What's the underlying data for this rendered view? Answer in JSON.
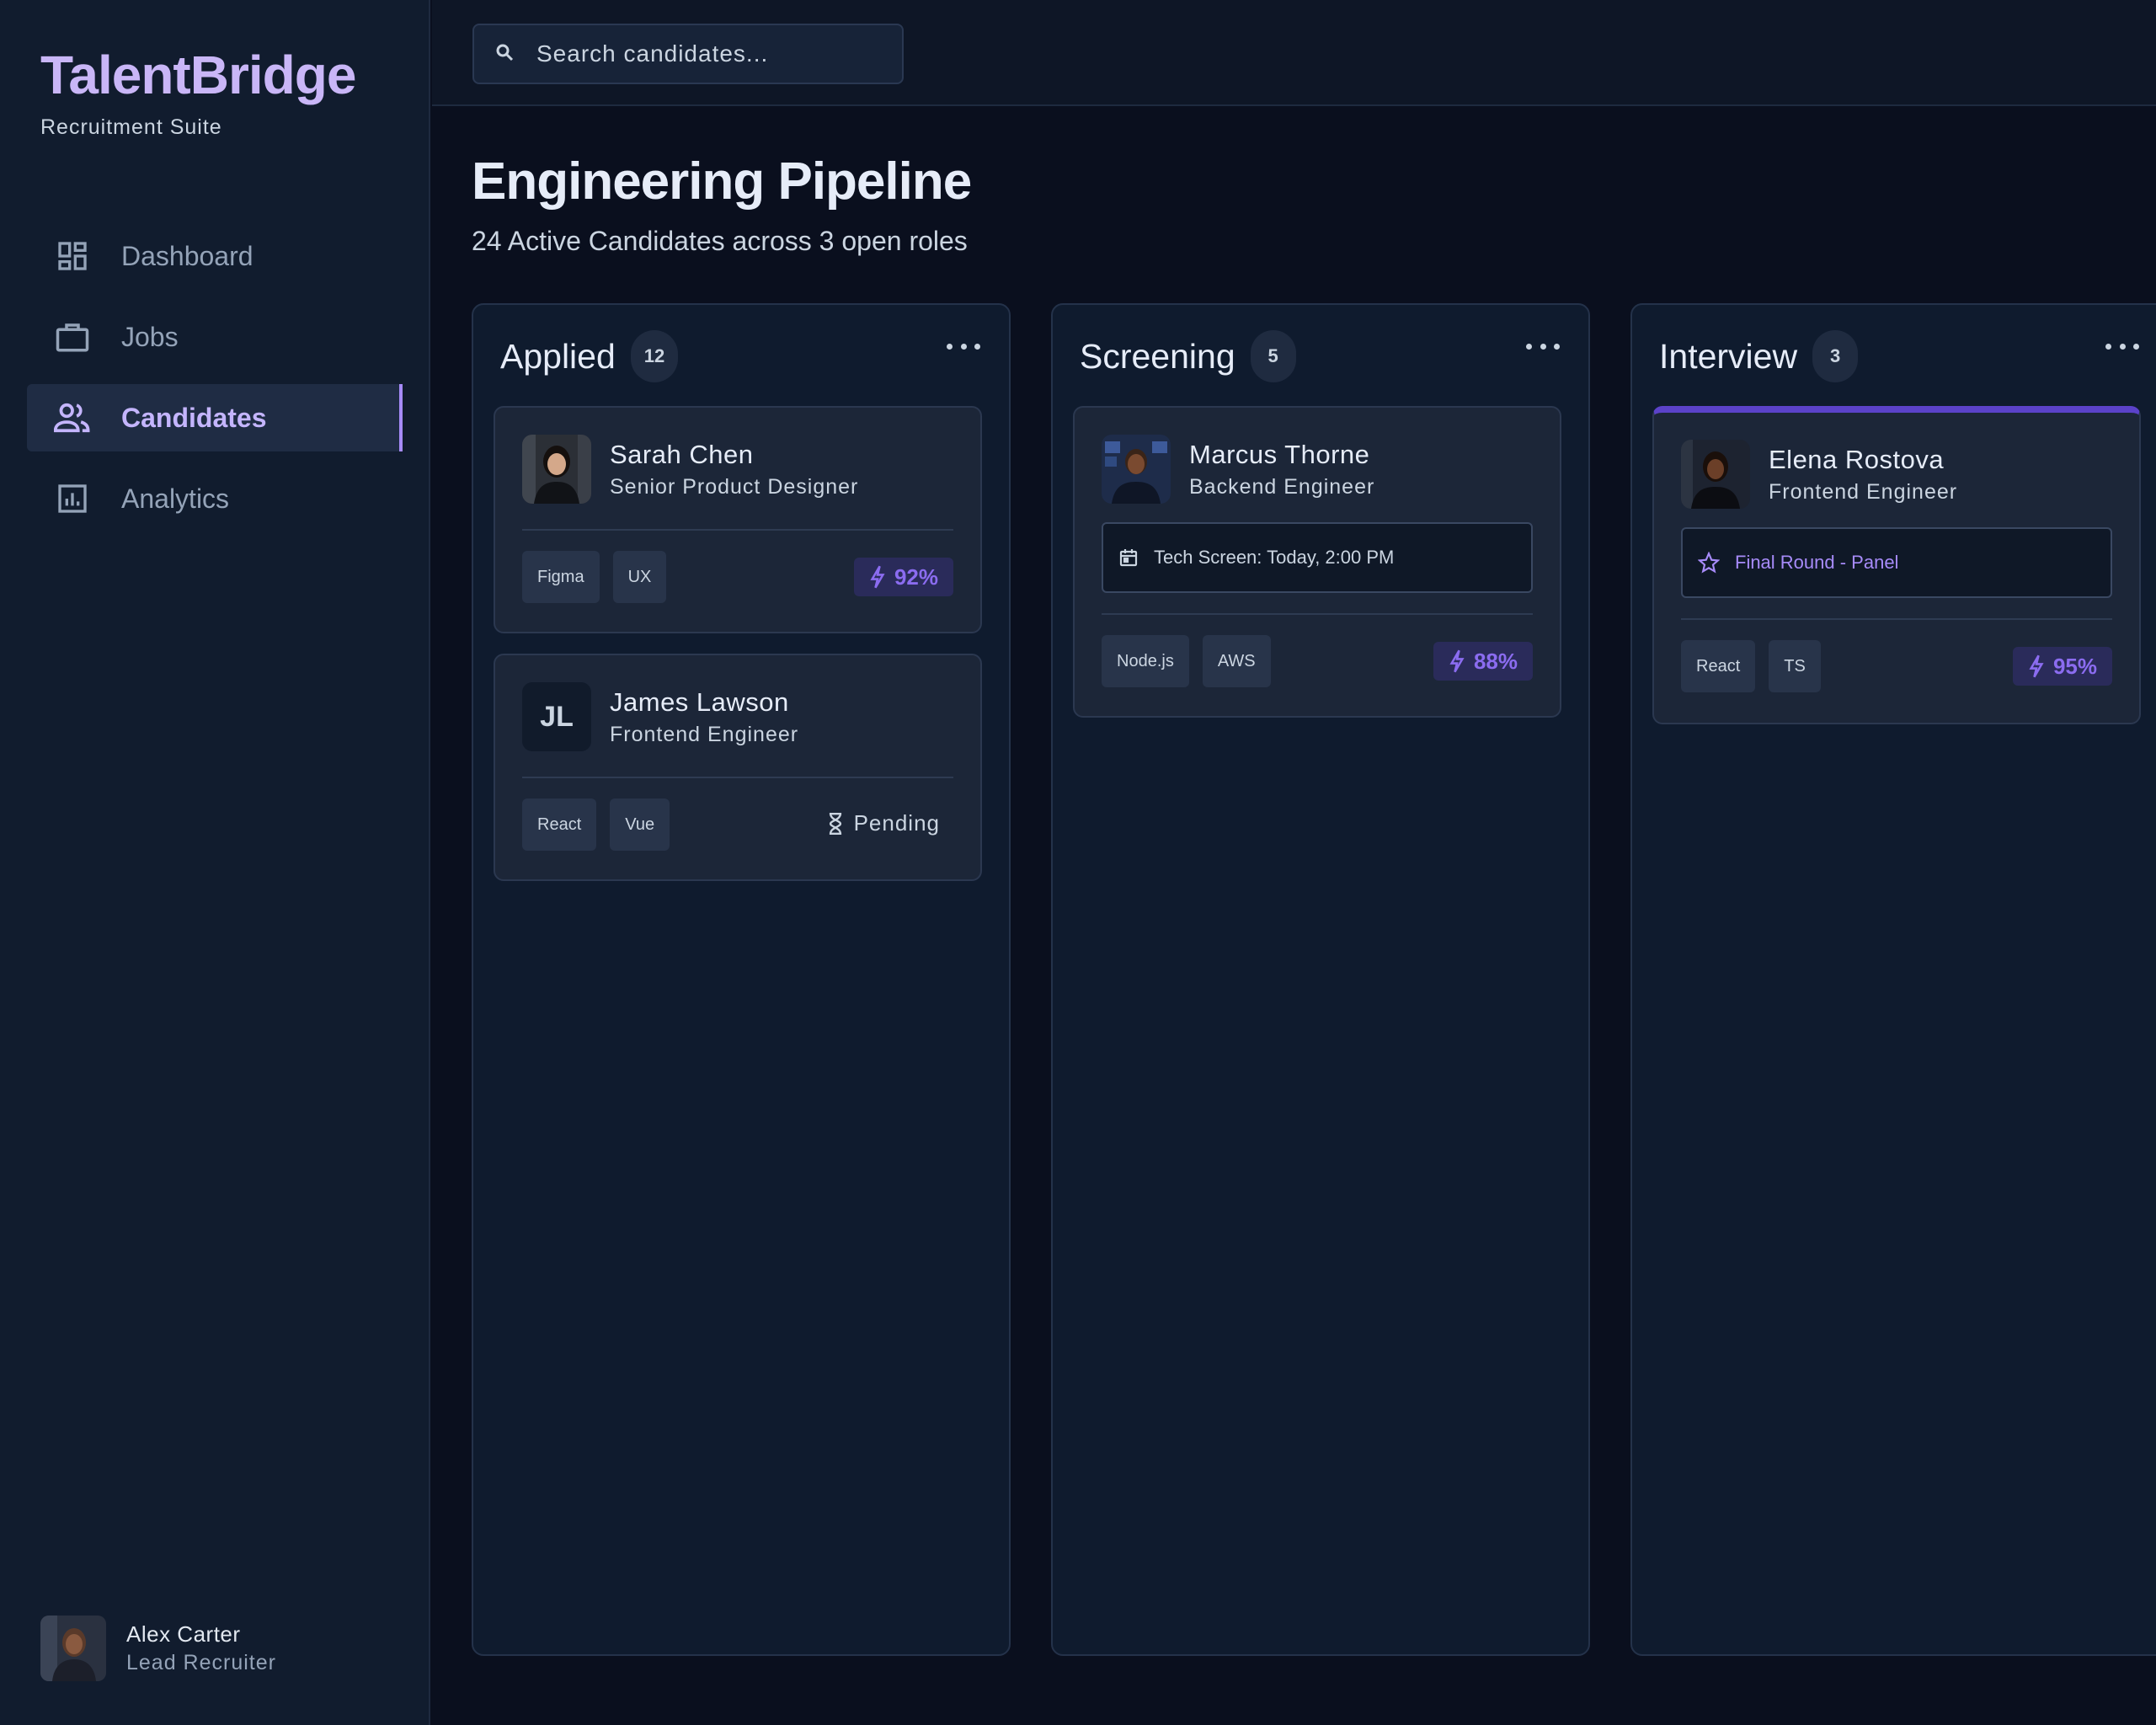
{
  "brand": {
    "name": "TalentBridge",
    "subtitle": "Recruitment Suite"
  },
  "nav": {
    "items": [
      {
        "label": "Dashboard",
        "icon": "dashboard-icon",
        "active": false
      },
      {
        "label": "Jobs",
        "icon": "briefcase-icon",
        "active": false
      },
      {
        "label": "Candidates",
        "icon": "people-icon",
        "active": true
      },
      {
        "label": "Analytics",
        "icon": "chart-icon",
        "active": false
      }
    ]
  },
  "user": {
    "name": "Alex Carter",
    "role": "Lead Recruiter"
  },
  "search": {
    "placeholder": "Search candidates..."
  },
  "page": {
    "title": "Engineering Pipeline",
    "subtitle": "24 Active Candidates across 3 open roles"
  },
  "columns": [
    {
      "title": "Applied",
      "count": "12",
      "cards": [
        {
          "name": "Sarah Chen",
          "role": "Senior Product Designer",
          "tags": [
            "Figma",
            "UX"
          ],
          "score": "92%"
        },
        {
          "name": "James Lawson",
          "initials": "JL",
          "role": "Frontend Engineer",
          "tags": [
            "React",
            "Vue"
          ],
          "status": "Pending"
        }
      ]
    },
    {
      "title": "Screening",
      "count": "5",
      "cards": [
        {
          "name": "Marcus Thorne",
          "role": "Backend Engineer",
          "event": "Tech Screen: Today, 2:00 PM",
          "tags": [
            "Node.js",
            "AWS"
          ],
          "score": "88%"
        }
      ]
    },
    {
      "title": "Interview",
      "count": "3",
      "cards": [
        {
          "name": "Elena Rostova",
          "role": "Frontend Engineer",
          "event": "Final Round - Panel",
          "tags": [
            "React",
            "TS"
          ],
          "score": "95%"
        }
      ]
    }
  ],
  "colors": {
    "accent": "#a78bfa",
    "background": "#0a0f1e",
    "sidebar": "#111c2e"
  }
}
